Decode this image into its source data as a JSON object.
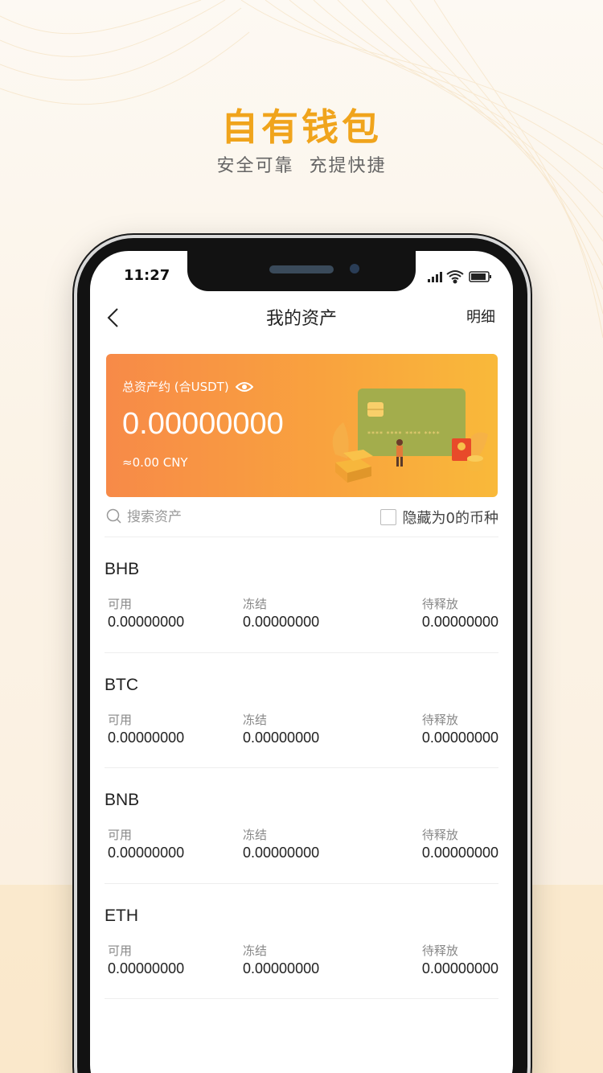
{
  "promo": {
    "title": "自有钱包",
    "subtitle": "安全可靠  充提快捷"
  },
  "status_bar": {
    "time": "11:27"
  },
  "nav": {
    "title": "我的资产",
    "detail_label": "明细"
  },
  "asset_card": {
    "label": "总资产约 (合USDT)",
    "amount": "0.00000000",
    "cny": "≈0.00 CNY",
    "card_mask": "****  ****  ****  ****"
  },
  "search": {
    "placeholder": "搜索资产",
    "hide_zero_label": "隐藏为0的币种"
  },
  "columns": {
    "available": "可用",
    "frozen": "冻结",
    "pending": "待释放"
  },
  "coins": [
    {
      "name": "BHB",
      "available": "0.00000000",
      "frozen": "0.00000000",
      "pending": "0.00000000"
    },
    {
      "name": "BTC",
      "available": "0.00000000",
      "frozen": "0.00000000",
      "pending": "0.00000000"
    },
    {
      "name": "BNB",
      "available": "0.00000000",
      "frozen": "0.00000000",
      "pending": "0.00000000"
    },
    {
      "name": "ETH",
      "available": "0.00000000",
      "frozen": "0.00000000",
      "pending": "0.00000000"
    }
  ],
  "colors": {
    "accent": "#f0a41c",
    "card_start": "#f78a48",
    "card_end": "#f9b93a"
  }
}
